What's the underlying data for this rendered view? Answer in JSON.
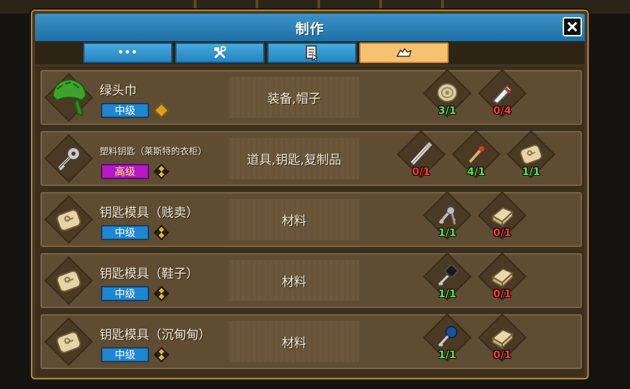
{
  "window": {
    "title": "制作",
    "close_icon": "close-x-icon"
  },
  "tabs": [
    {
      "label": "•••",
      "icon": "more-dots-icon",
      "active": false
    },
    {
      "label": "",
      "icon": "tools-icon",
      "active": false
    },
    {
      "label": "",
      "icon": "document-icon",
      "active": false
    },
    {
      "label": "",
      "icon": "cloth-icon",
      "active": true
    }
  ],
  "recipes": [
    {
      "name": "绿头巾",
      "grade": "中级",
      "grade_type": "mid",
      "rarity_icon": "gold-gem-icon",
      "category": "装备,帽子",
      "icon": "green-bandana-icon",
      "materials": [
        {
          "icon": "bandage-roll-icon",
          "count": "3/1",
          "ok": true
        },
        {
          "icon": "cloth-strip-icon",
          "count": "0/4",
          "ok": false
        }
      ]
    },
    {
      "name": "塑料钥匙（莱斯特的衣柜）",
      "grade": "高级",
      "grade_type": "high",
      "rarity_icon": "checker-gem-icon",
      "category": "道具,钥匙,复制品",
      "icon": "plastic-key-icon",
      "materials": [
        {
          "icon": "pipe-icon",
          "count": "0/1",
          "ok": false
        },
        {
          "icon": "match-icon",
          "count": "4/1",
          "ok": true
        },
        {
          "icon": "key-mold-icon",
          "count": "1/1",
          "ok": true
        }
      ]
    },
    {
      "name": "钥匙模具（贱卖）",
      "grade": "中级",
      "grade_type": "mid",
      "rarity_icon": "checker-gem-icon",
      "category": "材料",
      "icon": "key-mold-icon",
      "materials": [
        {
          "icon": "key-bunch-icon",
          "count": "1/1",
          "ok": true
        },
        {
          "icon": "clay-block-icon",
          "count": "0/1",
          "ok": false
        }
      ]
    },
    {
      "name": "钥匙模具（鞋子）",
      "grade": "中级",
      "grade_type": "mid",
      "rarity_icon": "checker-gem-icon",
      "category": "材料",
      "icon": "key-mold-icon",
      "materials": [
        {
          "icon": "black-key-icon",
          "count": "1/1",
          "ok": true
        },
        {
          "icon": "clay-block-icon",
          "count": "0/1",
          "ok": false
        }
      ]
    },
    {
      "name": "钥匙模具（沉甸甸）",
      "grade": "中级",
      "grade_type": "mid",
      "rarity_icon": "checker-gem-icon",
      "category": "材料",
      "icon": "key-mold-icon",
      "materials": [
        {
          "icon": "blue-key-icon",
          "count": "1/1",
          "ok": true
        },
        {
          "icon": "clay-block-icon",
          "count": "0/1",
          "ok": false
        }
      ]
    }
  ],
  "colors": {
    "title_bar": "#2a86c0",
    "tab_active": "#f6c271",
    "ok": "#5fe24a",
    "bad": "#ff3b3b",
    "grade_mid": "#1f86d2",
    "grade_high": "#b619c6"
  }
}
